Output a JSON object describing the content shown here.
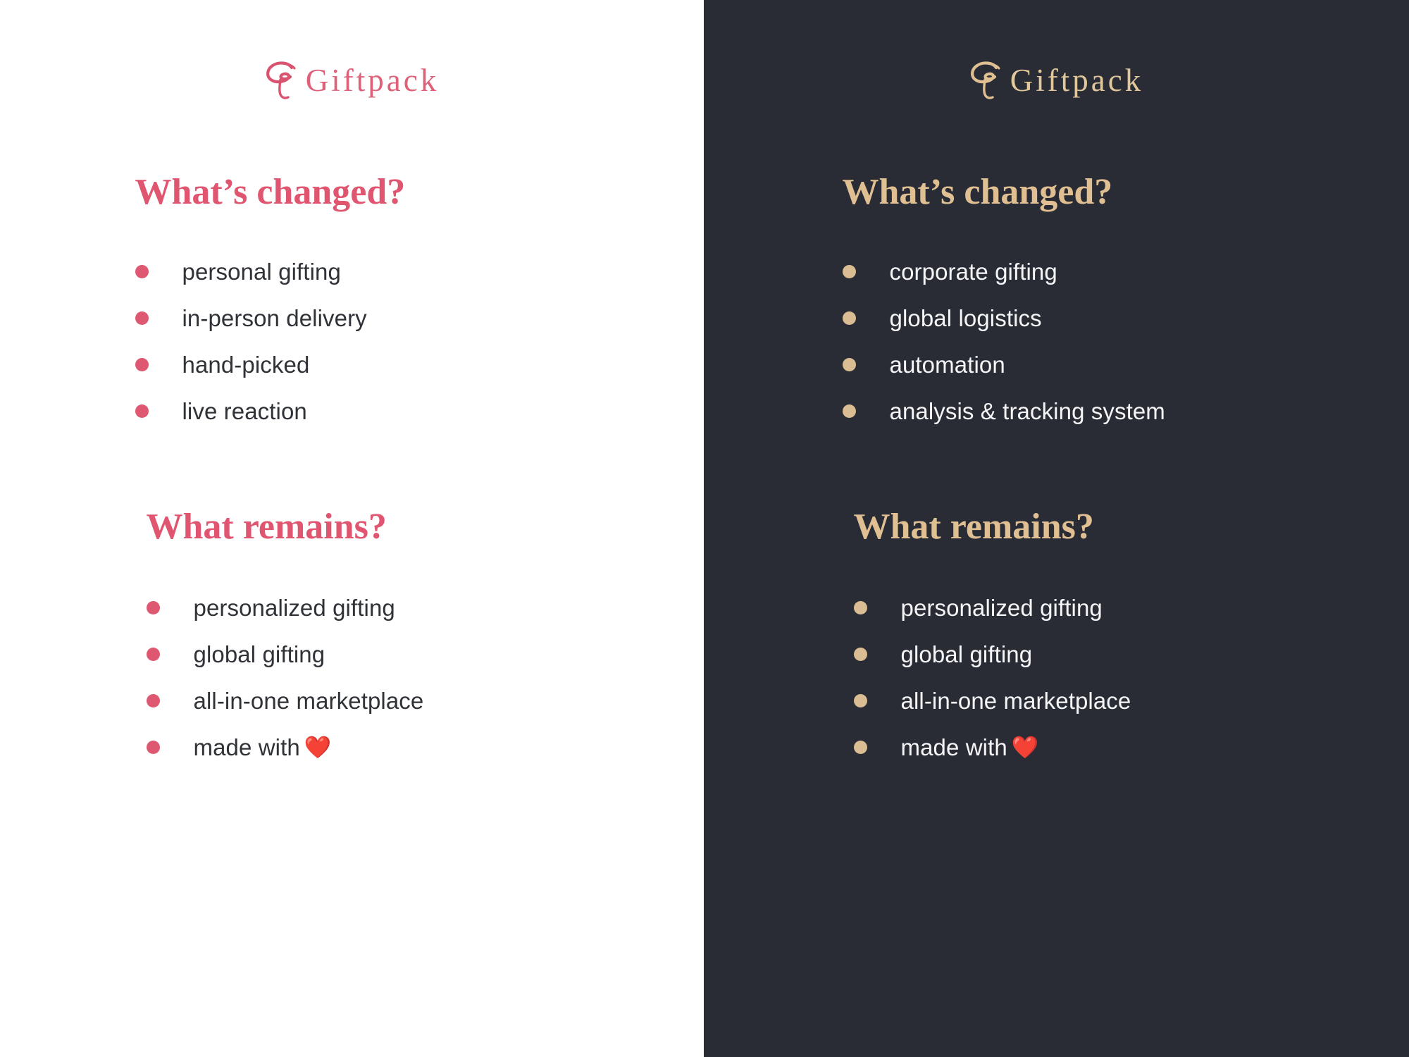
{
  "panels": [
    {
      "theme": "light",
      "background": "#ffffff",
      "accent": "#df5872",
      "text_color": "#2f3237",
      "brand": {
        "mark": "giftpack-g-mark",
        "name": "Giftpack"
      },
      "sections": [
        {
          "title": "What’s changed?",
          "items": [
            {
              "label": "personal gifting"
            },
            {
              "label": "in-person delivery"
            },
            {
              "label": "hand-picked"
            },
            {
              "label": "live reaction"
            }
          ]
        },
        {
          "title": "What remains?",
          "items": [
            {
              "label": "personalized gifting"
            },
            {
              "label": "global gifting"
            },
            {
              "label": "all-in-one marketplace"
            },
            {
              "label": "made with ",
              "emoji": "❤️"
            }
          ]
        }
      ]
    },
    {
      "theme": "dark",
      "background": "#292c35",
      "accent": "#dbbd94",
      "text_color": "#f4f5f7",
      "brand": {
        "mark": "giftpack-g-mark",
        "name": "Giftpack"
      },
      "sections": [
        {
          "title": "What’s changed?",
          "items": [
            {
              "label": "corporate gifting"
            },
            {
              "label": "global logistics"
            },
            {
              "label": "automation"
            },
            {
              "label": "analysis & tracking system"
            }
          ]
        },
        {
          "title": "What remains?",
          "items": [
            {
              "label": "personalized gifting"
            },
            {
              "label": "global gifting"
            },
            {
              "label": "all-in-one marketplace"
            },
            {
              "label": "made with ",
              "emoji": "❤️"
            }
          ]
        }
      ]
    }
  ]
}
